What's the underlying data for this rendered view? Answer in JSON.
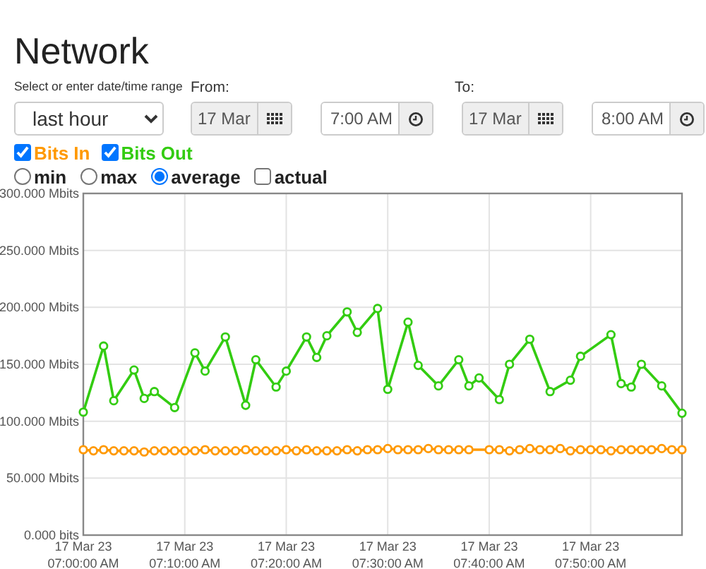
{
  "title": "Network",
  "range": {
    "label": "Select or enter date/time range",
    "value": "last hour"
  },
  "from": {
    "label": "From:",
    "date": "17 Mar",
    "time": "7:00 AM"
  },
  "to": {
    "label": "To:",
    "date": "17 Mar",
    "time": "8:00 AM"
  },
  "series_toggles": [
    {
      "checked": true,
      "color": "#ff9900"
    },
    {
      "checked": true,
      "color": "#33cc11"
    }
  ],
  "modes": [
    {
      "label": "min",
      "kind": "radio",
      "selected": false
    },
    {
      "label": "max",
      "kind": "radio",
      "selected": false
    },
    {
      "label": "average",
      "kind": "radio",
      "selected": true
    },
    {
      "label": "actual",
      "kind": "checkbox",
      "selected": false
    }
  ],
  "chart": {
    "chart_data": {
      "type": "line",
      "grid": true,
      "ylim": [
        0,
        300
      ],
      "categories": [
        "17 Mar 23\n07:00:00 AM",
        null,
        null,
        null,
        null,
        null,
        null,
        null,
        null,
        null,
        "17 Mar 23\n07:10:00 AM",
        null,
        null,
        null,
        null,
        null,
        null,
        null,
        null,
        null,
        "17 Mar 23\n07:20:00 AM",
        null,
        null,
        null,
        null,
        null,
        null,
        null,
        null,
        null,
        "17 Mar 23\n07:30:00 AM",
        null,
        null,
        null,
        null,
        null,
        null,
        null,
        null,
        null,
        "17 Mar 23\n07:40:00 AM",
        null,
        null,
        null,
        null,
        null,
        null,
        null,
        null,
        null,
        "17 Mar 23\n07:50:00 AM",
        null,
        null,
        null,
        null,
        null,
        null,
        null,
        null,
        null
      ],
      "yticks": [
        {
          "value": 0,
          "label": "0.000 bits"
        },
        {
          "value": 50,
          "label": "50.000 Mbits"
        },
        {
          "value": 100,
          "label": "100.000 Mbits"
        },
        {
          "value": 150,
          "label": "150.000 Mbits"
        },
        {
          "value": 200,
          "label": "200.000 Mbits"
        },
        {
          "value": 250,
          "label": "250.000 Mbits"
        },
        {
          "value": 300,
          "label": "300.000 Mbits"
        }
      ],
      "series": [
        {
          "name": "Bits In",
          "color": "#ff9900",
          "marker": "circle",
          "values": [
            75,
            74,
            75,
            74,
            74,
            74,
            73,
            74,
            74,
            74,
            74,
            74,
            75,
            74,
            74,
            74,
            75,
            74,
            74,
            74,
            75,
            74,
            75,
            74,
            74,
            74,
            75,
            74,
            75,
            75,
            76,
            75,
            75,
            75,
            76,
            75,
            75,
            75,
            75,
            null,
            75,
            75,
            74,
            75,
            76,
            75,
            75,
            76,
            74,
            75,
            75,
            75,
            74,
            75,
            75,
            75,
            75,
            76,
            75,
            75
          ]
        },
        {
          "name": "Bits Out",
          "color": "#33cc11",
          "marker": "circle",
          "values": [
            108,
            null,
            166,
            118,
            null,
            145,
            120,
            126,
            null,
            112,
            null,
            160,
            144,
            null,
            174,
            null,
            114,
            154,
            null,
            130,
            144,
            null,
            174,
            156,
            175,
            null,
            196,
            178,
            null,
            199,
            128,
            null,
            187,
            149,
            null,
            131,
            null,
            154,
            131,
            138,
            null,
            119,
            150,
            null,
            172,
            null,
            126,
            null,
            136,
            157,
            null,
            null,
            176,
            133,
            130,
            150,
            null,
            131,
            null,
            107
          ]
        }
      ]
    }
  }
}
